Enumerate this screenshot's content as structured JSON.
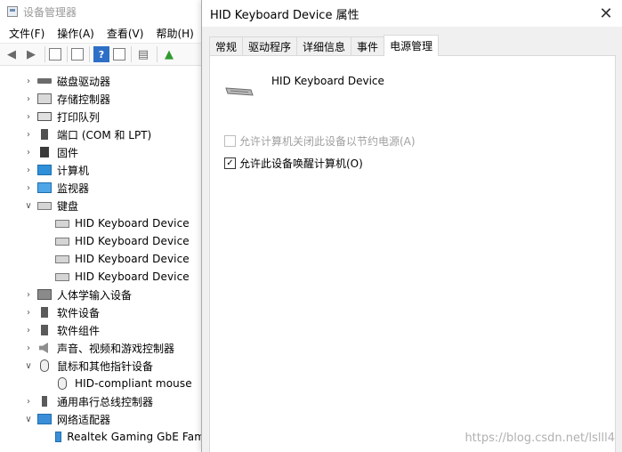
{
  "device_manager": {
    "title": "设备管理器",
    "menus": [
      "文件(F)",
      "操作(A)",
      "查看(V)",
      "帮助(H)"
    ],
    "toolbar_icons": [
      "back-arrow-icon",
      "forward-arrow-icon",
      "properties-icon",
      "list-icon",
      "help-icon",
      "show-icon",
      "monitor-icon",
      "update-driver-icon"
    ],
    "tree": [
      {
        "label": "磁盘驱动器",
        "expanded": false,
        "icon": "disk-drive-icon",
        "cls": "ic-disk"
      },
      {
        "label": "存储控制器",
        "expanded": false,
        "icon": "storage-controller-icon",
        "cls": "ic-storage"
      },
      {
        "label": "打印队列",
        "expanded": false,
        "icon": "printer-icon",
        "cls": "ic-printer"
      },
      {
        "label": "端口 (COM 和 LPT)",
        "expanded": false,
        "icon": "port-icon",
        "cls": "ic-port"
      },
      {
        "label": "固件",
        "expanded": false,
        "icon": "firmware-icon",
        "cls": "ic-firmware"
      },
      {
        "label": "计算机",
        "expanded": false,
        "icon": "computer-icon",
        "cls": "ic-computer"
      },
      {
        "label": "监视器",
        "expanded": false,
        "icon": "monitor-icon",
        "cls": "ic-monitor"
      },
      {
        "label": "键盘",
        "expanded": true,
        "icon": "keyboard-icon",
        "cls": "ic-keyboard"
      },
      {
        "label": "HID Keyboard Device",
        "child": true,
        "icon": "keyboard-icon",
        "cls": "ic-keyboard"
      },
      {
        "label": "HID Keyboard Device",
        "child": true,
        "icon": "keyboard-icon",
        "cls": "ic-keyboard"
      },
      {
        "label": "HID Keyboard Device",
        "child": true,
        "icon": "keyboard-icon",
        "cls": "ic-keyboard"
      },
      {
        "label": "HID Keyboard Device",
        "child": true,
        "icon": "keyboard-icon",
        "cls": "ic-keyboard"
      },
      {
        "label": "人体学输入设备",
        "expanded": false,
        "icon": "hid-icon",
        "cls": "ic-hid"
      },
      {
        "label": "软件设备",
        "expanded": false,
        "icon": "software-device-icon",
        "cls": "ic-sw"
      },
      {
        "label": "软件组件",
        "expanded": false,
        "icon": "software-component-icon",
        "cls": "ic-sw"
      },
      {
        "label": "声音、视频和游戏控制器",
        "expanded": false,
        "icon": "audio-icon",
        "cls": "ic-audio"
      },
      {
        "label": "鼠标和其他指针设备",
        "expanded": true,
        "icon": "mouse-icon",
        "cls": "ic-mouse"
      },
      {
        "label": "HID-compliant mouse",
        "child": true,
        "icon": "mouse-icon",
        "cls": "ic-mouse"
      },
      {
        "label": "通用串行总线控制器",
        "expanded": false,
        "icon": "usb-icon",
        "cls": "ic-usb"
      },
      {
        "label": "网络适配器",
        "expanded": true,
        "icon": "network-adapter-icon",
        "cls": "ic-net"
      },
      {
        "label": "Realtek Gaming GbE Fam",
        "child": true,
        "icon": "network-adapter-icon",
        "cls": "ic-net"
      }
    ]
  },
  "dialog": {
    "title": "HID Keyboard Device 属性",
    "tabs": [
      "常规",
      "驱动程序",
      "详细信息",
      "事件",
      "电源管理"
    ],
    "active_tab": 4,
    "device_name": "HID Keyboard Device",
    "options": {
      "power_off": {
        "label": "允许计算机关闭此设备以节约电源(A)",
        "checked": false,
        "enabled": false
      },
      "wake": {
        "label": "允许此设备唤醒计算机(O)",
        "checked": true,
        "enabled": true
      }
    }
  },
  "watermark": "https://blog.csdn.net/lslll4"
}
